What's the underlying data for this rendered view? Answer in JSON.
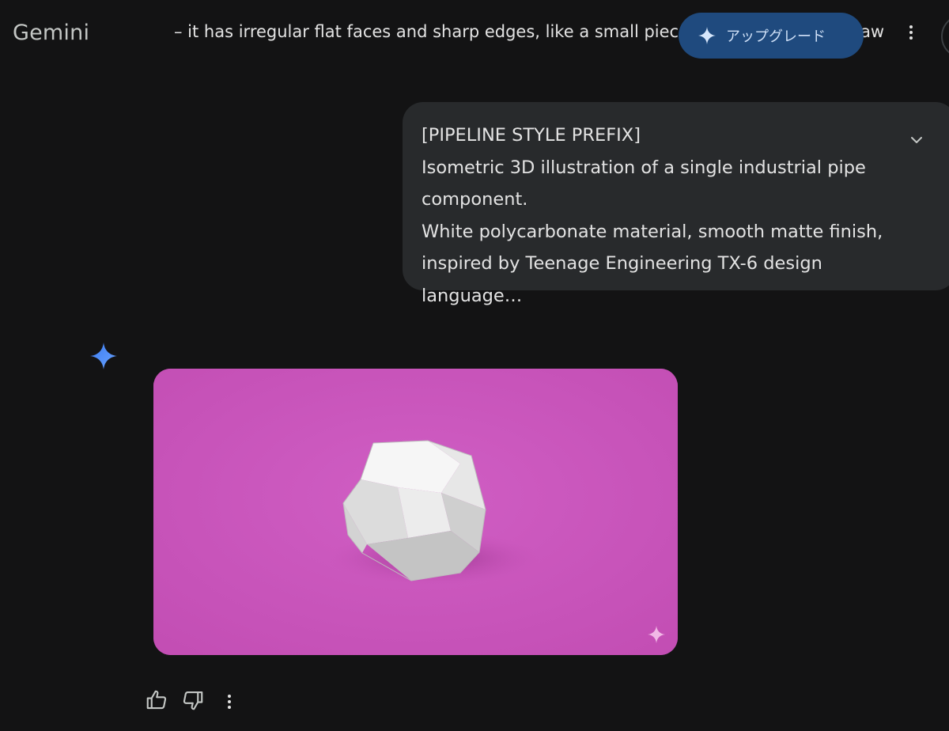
{
  "header": {
    "brand": "Gemini",
    "conversation_title": "– it has irregular flat faces and sharp edges, like a small piece of natural stone or raw",
    "upgrade_label": "アップグレード",
    "upgrade_icon": "sparkle-icon",
    "menu_icon": "more-vert-icon"
  },
  "prompt": {
    "lines": [
      "[PIPELINE STYLE PREFIX]",
      "Isometric 3D illustration of a single industrial pipe",
      "component.",
      "White polycarbonate material, smooth matte finish,",
      "inspired by Teenage Engineering TX-6 design language…"
    ],
    "expand_icon": "chevron-down-icon"
  },
  "response": {
    "avatar_icon": "gemini-sparkle-icon",
    "image_background": "#c854bb",
    "watermark_icon": "sparkle-watermark-icon"
  },
  "actions": {
    "thumbs_up_icon": "thumbs-up-icon",
    "thumbs_down_icon": "thumbs-down-icon",
    "more_icon": "more-vert-icon"
  },
  "colors": {
    "background": "#131314",
    "bubble": "#282a2c",
    "upgrade_bg": "#1f4a7e",
    "accent_blue": "#4c8df6"
  }
}
